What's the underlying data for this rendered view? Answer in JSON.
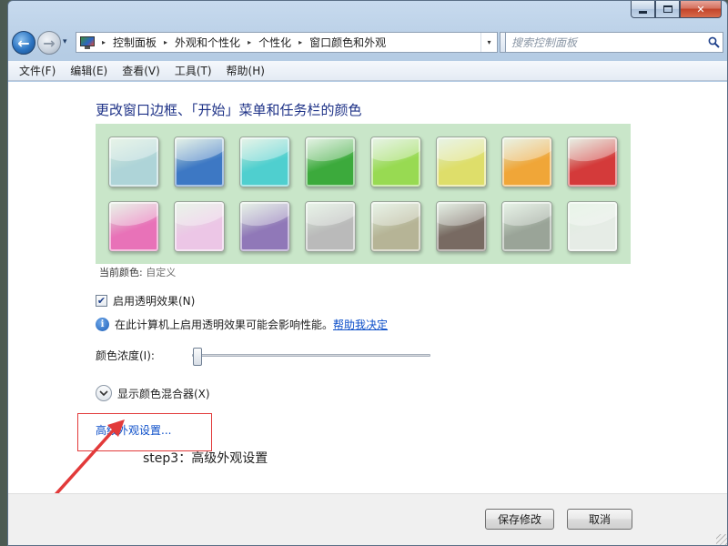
{
  "window": {
    "caption_min": "",
    "caption_max": "",
    "caption_close": "✕"
  },
  "nav": {
    "back_glyph": "←",
    "forward_glyph": "→",
    "history_glyph": "▾"
  },
  "address": {
    "crumbs": [
      "控制面板",
      "外观和个性化",
      "个性化",
      "窗口颜色和外观"
    ],
    "arrow": "▸"
  },
  "search": {
    "placeholder": "搜索控制面板"
  },
  "menu": {
    "file": "文件(F)",
    "edit": "编辑(E)",
    "view": "查看(V)",
    "tools": "工具(T)",
    "help": "帮助(H)"
  },
  "content": {
    "title": "更改窗口边框、「开始」菜单和任务栏的颜色",
    "swatch_colors": [
      "#aed4d8",
      "#3d78c4",
      "#4fcfcf",
      "#3caa3c",
      "#98da52",
      "#dede6a",
      "#f0a638",
      "#d43a3a",
      "#e872b8",
      "#ecc6e6",
      "#9078b8",
      "#bababa",
      "#b6b496",
      "#786a62",
      "#9aa498",
      "#e6ece6"
    ],
    "current_color_label": "当前颜色:",
    "current_color_value": "自定义",
    "transparency_checked": "✔",
    "transparency_label": "启用透明效果(N)",
    "info_text": "在此计算机上启用透明效果可能会影响性能。",
    "info_link": "帮助我决定",
    "intensity_label": "颜色浓度(I):",
    "intensity_value": 0.0,
    "mixer_label": "显示颜色混合器(X)",
    "advanced_link": "高级外观设置...",
    "step_annotation": "step3：高级外观设置",
    "annotation_color": "#e23a3a"
  },
  "buttons": {
    "save": "保存修改",
    "cancel": "取消"
  }
}
